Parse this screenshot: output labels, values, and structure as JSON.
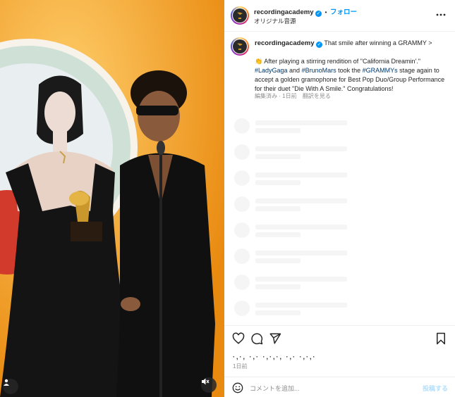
{
  "media": {
    "profile_icon": "person-icon",
    "mute_icon": "speaker-muted-icon"
  },
  "header": {
    "username": "recordingacademy",
    "separator": "•",
    "follow_label": "フォロー",
    "audio_label": "オリジナル音源",
    "more_icon": "more-icon"
  },
  "caption": {
    "username": "recordingacademy",
    "title_link": "That smile after winning a GRAMMY >",
    "emoji": "👏",
    "text1": " After playing a stirring rendition of \"California Dreamin'.\" ",
    "tag1": "#LadyGaga",
    "text2": " and ",
    "tag2": "#BrunoMars",
    "text3": " took the ",
    "tag3": "#GRAMMYs",
    "text4": " stage again to accept a golden gramophone for Best Pop Duo/Group Performance for their duet \"Die With A Smile.\" Congratulations!",
    "edited": "編集済み",
    "dot": "·",
    "time": "1日前",
    "see_translation": "翻訳を見る"
  },
  "actions": {
    "like_icon": "heart-icon",
    "comment_icon": "comment-icon",
    "share_icon": "send-icon",
    "save_icon": "bookmark-icon",
    "likes_text": "·,·, ·,· ·,·,·, ·,·  ·,·,·",
    "date": "1日前"
  },
  "comment": {
    "emoji_icon": "emoji-icon",
    "placeholder": "コメントを追加...",
    "post_label": "投稿する"
  },
  "colors": {
    "accent": "#0095f6",
    "hashtag": "#00376b",
    "muted": "#8e8e8e",
    "background_orange": "#f4a12a"
  }
}
